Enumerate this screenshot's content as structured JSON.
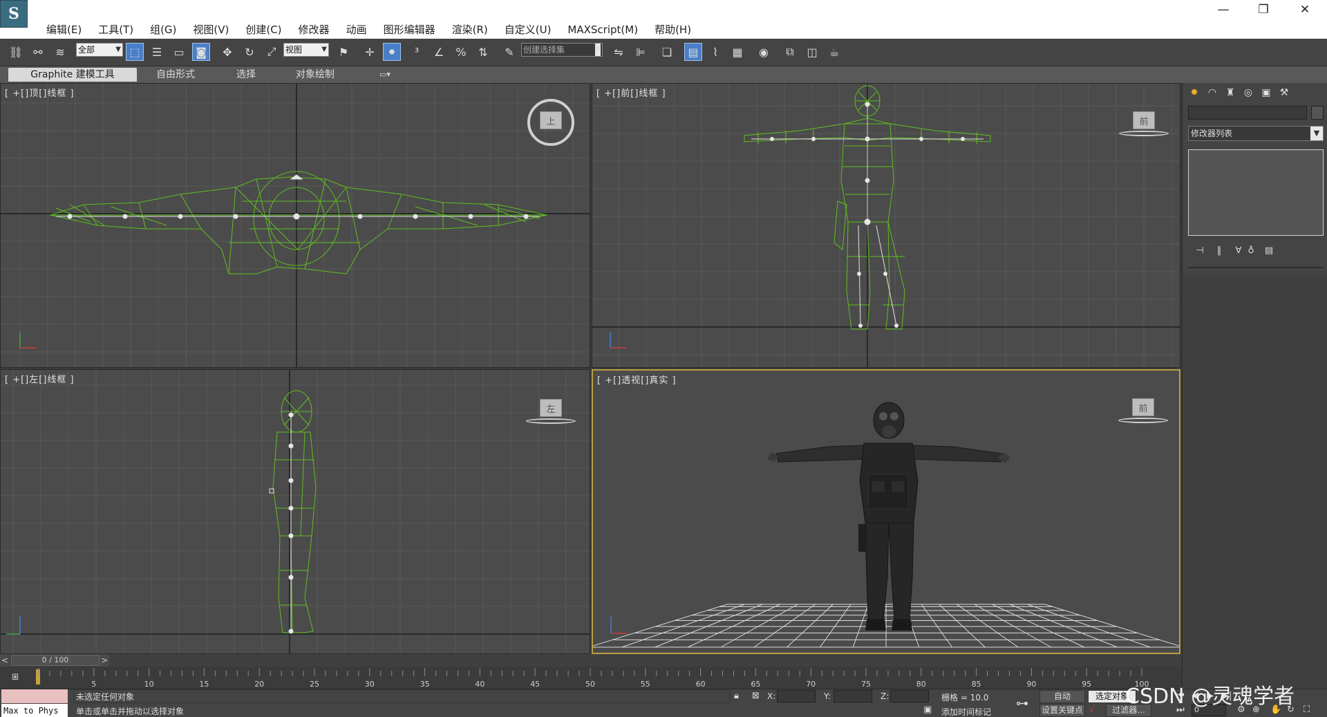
{
  "menu": {
    "items": [
      "编辑(E)",
      "工具(T)",
      "组(G)",
      "视图(V)",
      "创建(C)",
      "修改器",
      "动画",
      "图形编辑器",
      "渲染(R)",
      "自定义(U)",
      "MAXScript(M)",
      "帮助(H)"
    ]
  },
  "window_controls": {
    "minimize": "—",
    "restore": "❐",
    "close": "✕"
  },
  "toolbar": {
    "selection_filter": "全部",
    "ref_coord": "视图",
    "named_selection_placeholder": "创建选择集"
  },
  "ribbon": {
    "tabs": [
      "Graphite 建模工具",
      "自由形式",
      "选择",
      "对象绘制"
    ]
  },
  "viewports": {
    "top": {
      "label": "[ +[]顶[]线框 ]",
      "cube": "上"
    },
    "front": {
      "label": "[ +[]前[]线框 ]",
      "cube": "前"
    },
    "left": {
      "label": "[ +[]左[]线框 ]",
      "cube": "左"
    },
    "perspective": {
      "label": "[ +[]透视[]真实 ]",
      "cube": "前"
    }
  },
  "command_panel": {
    "modifier_list": "修改器列表"
  },
  "time_slider": {
    "position": "0 / 100",
    "current_frame": 0,
    "total_frames": 100
  },
  "trackbar": {
    "ticks": [
      5,
      10,
      15,
      20,
      25,
      30,
      35,
      40,
      45,
      50,
      55,
      60,
      65,
      70,
      75,
      80,
      85,
      90,
      95,
      100
    ]
  },
  "status": {
    "script_listener": "Max to Phys",
    "selection_status": "未选定任何对象",
    "prompt": "单击或单击并拖动以选择对象",
    "x_label": "X:",
    "y_label": "Y:",
    "z_label": "Z:",
    "grid": "栅格 = 10.0",
    "add_time_tag": "添加时间标记",
    "auto_key": "自动",
    "selected_object": "选定对象",
    "set_key": "设置关键点",
    "filters": "过滤器...",
    "frame_value": "0"
  },
  "watermark": "CSDN @灵魂学者",
  "colors": {
    "wireframe": "#5fbf1f",
    "viewport_bg": "#4b4b4b",
    "active_border": "#b8a040",
    "toolbar_active": "#4a7fc8"
  }
}
